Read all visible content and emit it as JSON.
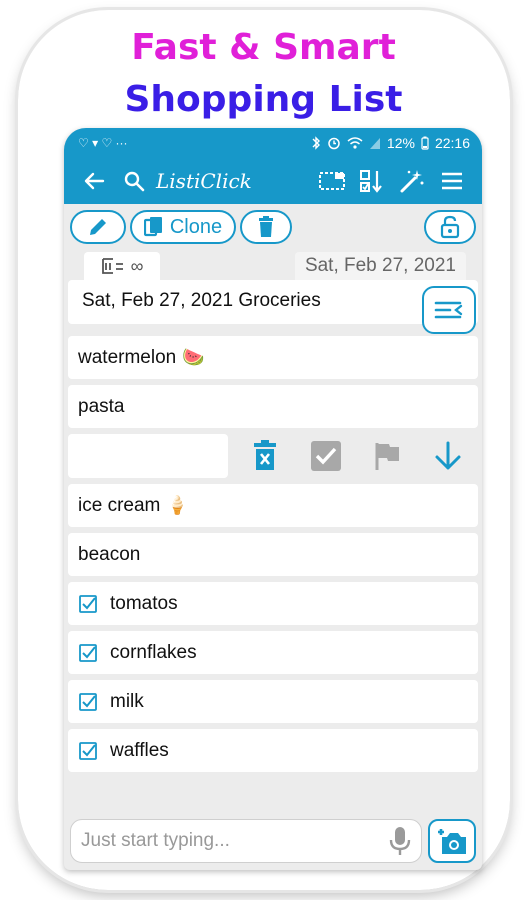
{
  "promo": {
    "line1": "Fast & Smart",
    "line2": "Shopping List"
  },
  "status_bar": {
    "left_icons": "♡ ▾ ♡  ···",
    "battery": "12%",
    "time": "22:16"
  },
  "toolbar": {
    "app_title": "ListiClick"
  },
  "actions": {
    "clone_label": "Clone"
  },
  "list_meta": {
    "tag_symbol": "∞",
    "date": "Sat, Feb 27, 2021"
  },
  "list_title": "Sat, Feb 27, 2021 Groceries",
  "items_top": [
    {
      "label": "watermelon",
      "emoji": "🍉"
    },
    {
      "label": "pasta",
      "emoji": ""
    }
  ],
  "items_middle": [
    {
      "label": "ice cream",
      "emoji": "🍦"
    },
    {
      "label": "beacon",
      "emoji": ""
    }
  ],
  "items_checked": [
    {
      "label": "tomatos"
    },
    {
      "label": "cornflakes"
    },
    {
      "label": "milk"
    },
    {
      "label": "waffles"
    }
  ],
  "entry": {
    "placeholder": "Just start typing..."
  },
  "colors": {
    "accent": "#1798c9",
    "promo_pink": "#e020d8",
    "promo_blue": "#3a1ee6",
    "background": "#ececec"
  },
  "icons": [
    "back-arrow-icon",
    "search-icon",
    "select-icon",
    "sort-icon",
    "magic-wand-icon",
    "menu-icon",
    "pencil-icon",
    "copy-icon",
    "trash-icon",
    "lock-icon",
    "list-filter-icon",
    "checkbox-icon",
    "flag-icon",
    "arrow-down-icon",
    "microphone-icon",
    "add-photo-icon"
  ]
}
